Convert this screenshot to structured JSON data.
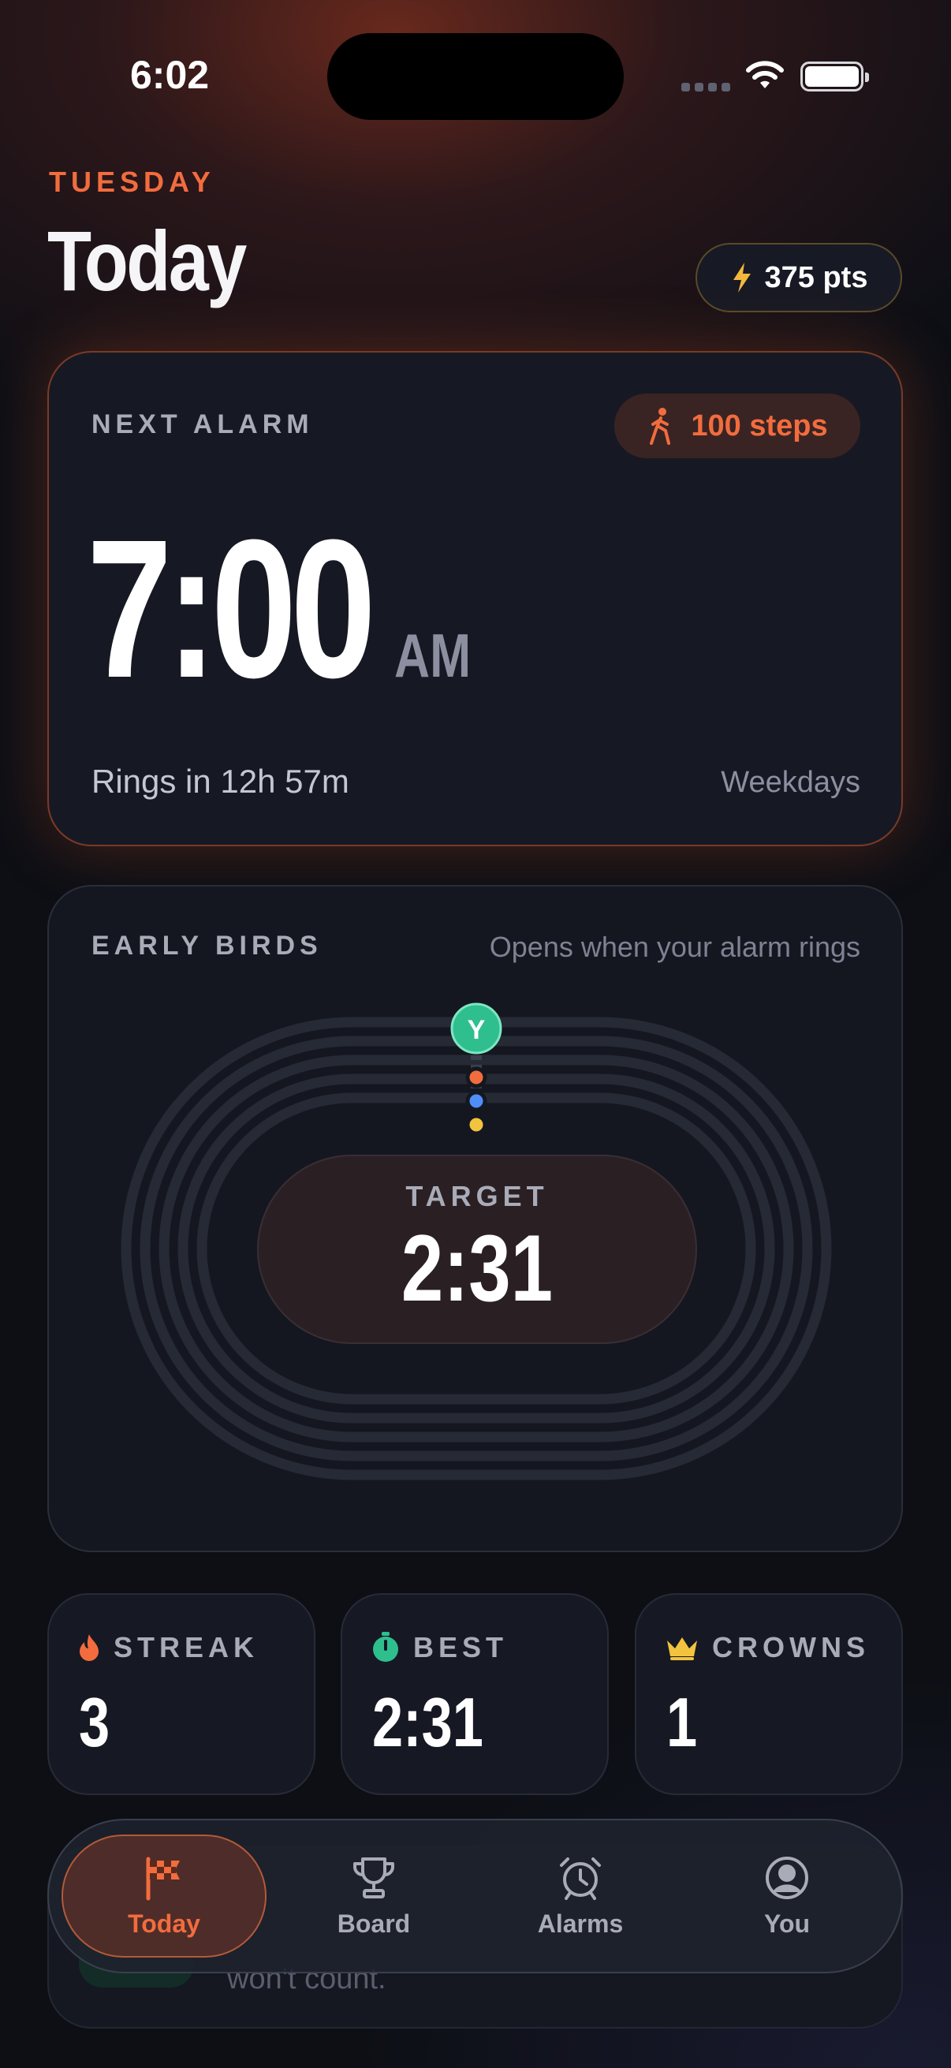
{
  "status_bar": {
    "time": "6:02"
  },
  "header": {
    "day": "TUESDAY",
    "title": "Today",
    "points": "375 pts"
  },
  "next_alarm": {
    "label": "NEXT ALARM",
    "steps": "100 steps",
    "time": "7:00",
    "ampm": "AM",
    "countdown": "Rings in 12h 57m",
    "repeat": "Weekdays"
  },
  "early_birds": {
    "label": "EARLY BIRDS",
    "subtitle": "Opens when your alarm rings",
    "avatar_initial": "Y",
    "target_label": "TARGET",
    "target_time": "2:31",
    "racer_colors": [
      "#f26c3e",
      "#4f8ef7",
      "#f2c33e"
    ],
    "avatar_color": "#2fbf8f"
  },
  "stats": [
    {
      "label": "STREAK",
      "value": "3",
      "icon": "flame-icon"
    },
    {
      "label": "BEST",
      "value": "2:31",
      "icon": "stopwatch-icon"
    },
    {
      "label": "CROWNS",
      "value": "1",
      "icon": "crown-icon"
    }
  ],
  "behind_card": {
    "text": "won't count."
  },
  "tabs": [
    {
      "label": "Today",
      "icon": "flag-icon",
      "active": true
    },
    {
      "label": "Board",
      "icon": "trophy-icon",
      "active": false
    },
    {
      "label": "Alarms",
      "icon": "alarm-clock-icon",
      "active": false
    },
    {
      "label": "You",
      "icon": "profile-icon",
      "active": false
    }
  ],
  "colors": {
    "accent": "#f26c3e",
    "background": "#0d0f15",
    "card": "#161923"
  }
}
